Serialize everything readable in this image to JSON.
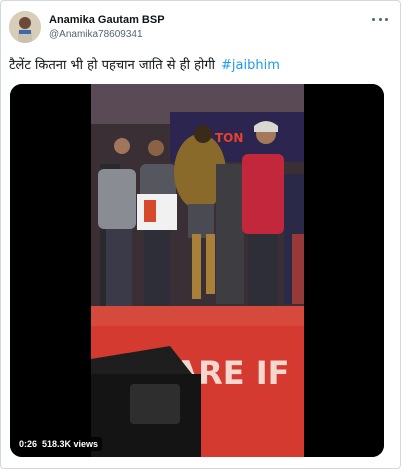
{
  "author": {
    "display_name": "Anamika Gautam BSP",
    "handle": "@Anamika78609341"
  },
  "tweet": {
    "text": "टैलेंट कितना भी हो पहचान जाति से ही होगी",
    "hashtag": "#jaibhim"
  },
  "video": {
    "duration": "0:26",
    "views": "518.3K views",
    "banner_text": "WE ARE IF",
    "sign_text": "TON"
  },
  "icons": {
    "more": "more-horizontal-icon",
    "avatar": "avatar-image"
  }
}
